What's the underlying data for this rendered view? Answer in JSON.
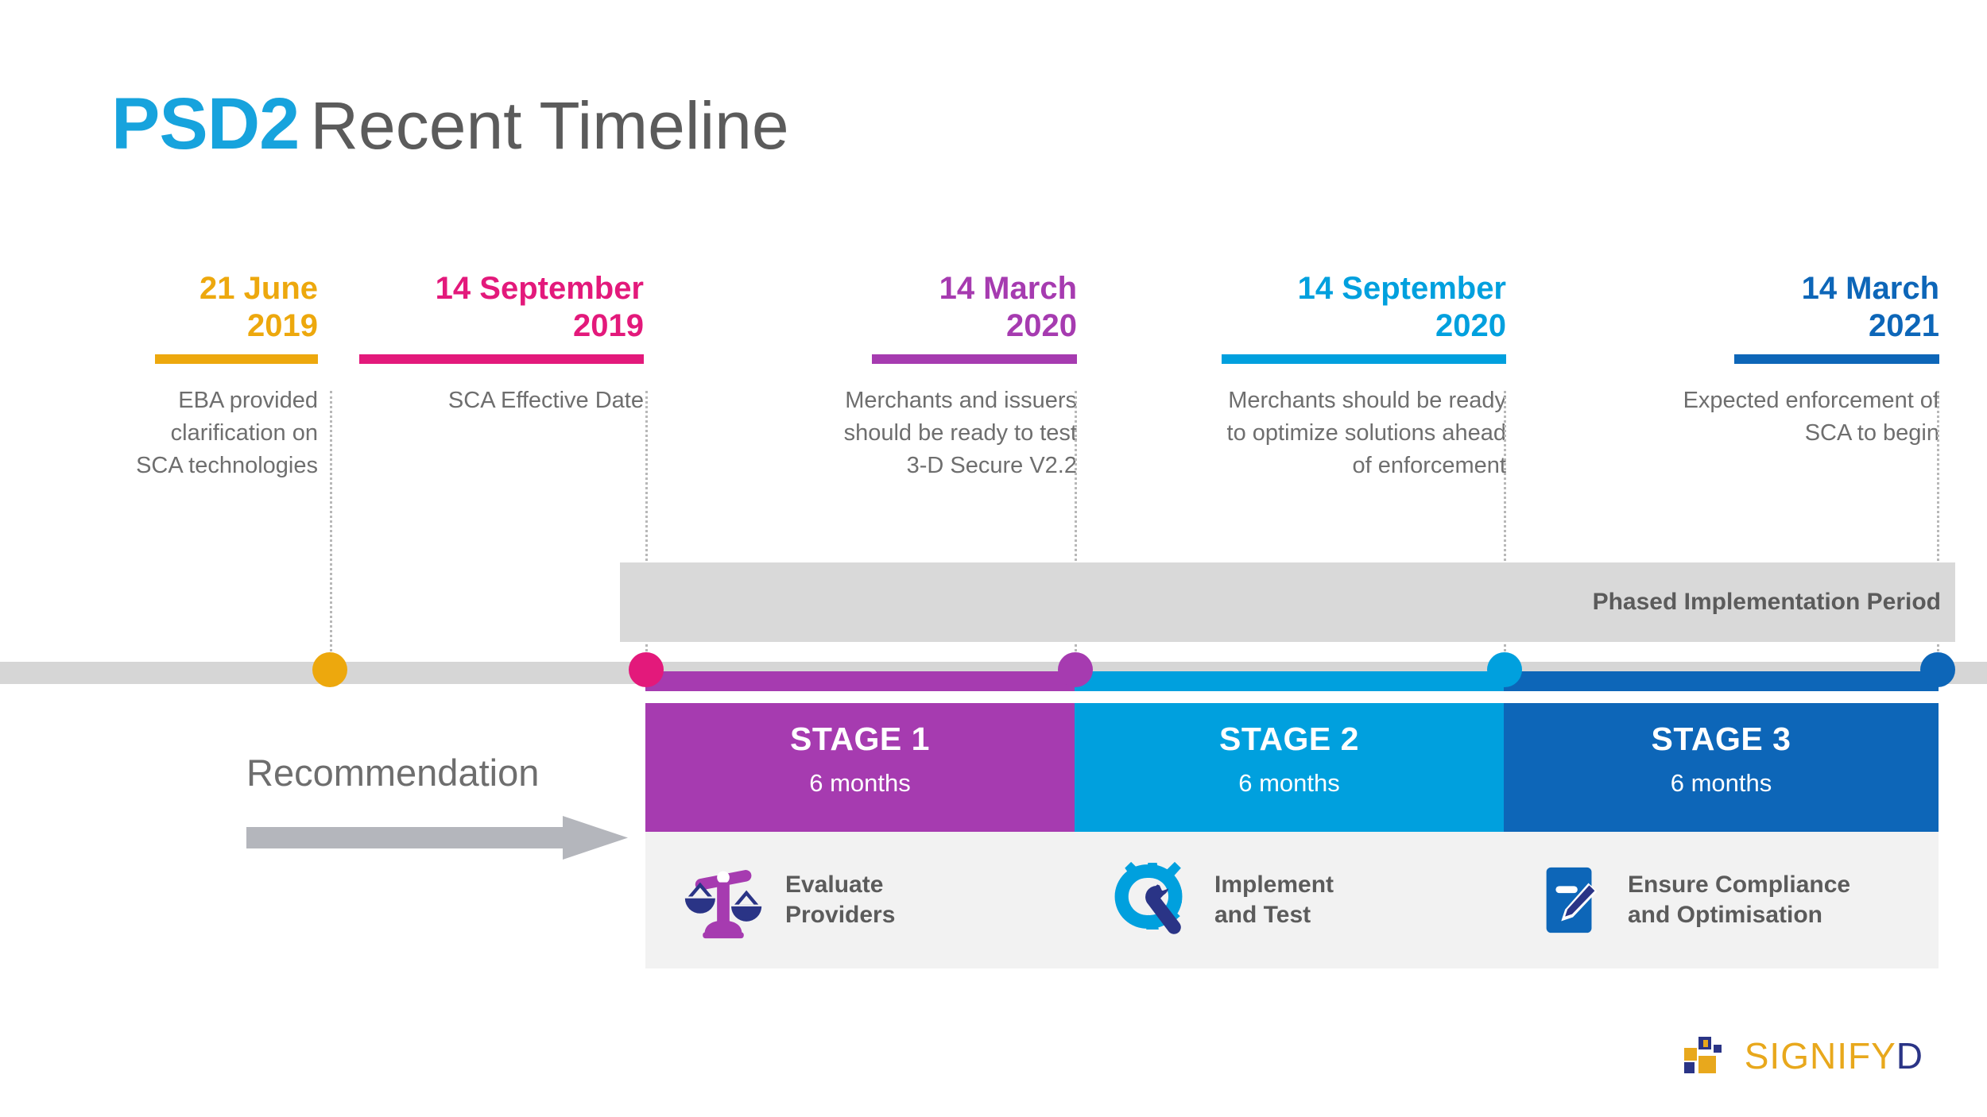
{
  "title": {
    "brand": "PSD2",
    "rest": "Recent Timeline",
    "brand_color": "#17A3DD",
    "rest_color": "#5B5B5B"
  },
  "colors": {
    "orange": "#EDA80D",
    "magenta": "#E3197B",
    "purple": "#A63BB0",
    "cyan": "#00A0DE",
    "blue": "#0D66B8",
    "rail_grey": "#D6D6D6",
    "band_grey": "#D9D9D9",
    "card_grey": "#F2F2F2",
    "text_grey": "#6E6E6E",
    "icon_navy": "#2A3486"
  },
  "milestones": [
    {
      "date": "21 June\n2019",
      "color": "#EDA80D",
      "description": "EBA provided\nclarification on\nSCA technologies"
    },
    {
      "date": "14 September\n2019",
      "color": "#E3197B",
      "description": "SCA Effective Date"
    },
    {
      "date": "14 March\n2020",
      "color": "#A63BB0",
      "description": "Merchants and issuers\nshould be ready to test\n3-D Secure V2.2"
    },
    {
      "date": "14 September\n2020",
      "color": "#00A0DE",
      "description": "Merchants should be ready\nto optimize solutions ahead\nof enforcement"
    },
    {
      "date": "14 March\n2021",
      "color": "#0D66B8",
      "description": "Expected enforcement of\nSCA to begin"
    }
  ],
  "phase_band": {
    "label": "Phased Implementation Period"
  },
  "recommendation": {
    "label": "Recommendation",
    "arrow_color": "#B4B6BC"
  },
  "stages": [
    {
      "name": "STAGE 1",
      "duration": "6 months",
      "task": "Evaluate\nProviders",
      "color": "#A63BB0",
      "icon": "scales-icon"
    },
    {
      "name": "STAGE 2",
      "duration": "6 months",
      "task": "Implement\nand Test",
      "color": "#00A0DE",
      "icon": "gear-wrench-icon"
    },
    {
      "name": "STAGE 3",
      "duration": "6 months",
      "task": "Ensure Compliance\nand Optimisation",
      "color": "#0D66B8",
      "icon": "document-pencil-icon"
    }
  ],
  "logo": {
    "text_main": "SIGNIFY",
    "text_accent": "D",
    "mark_orange": "#E8A81C",
    "mark_navy": "#2A3486"
  }
}
